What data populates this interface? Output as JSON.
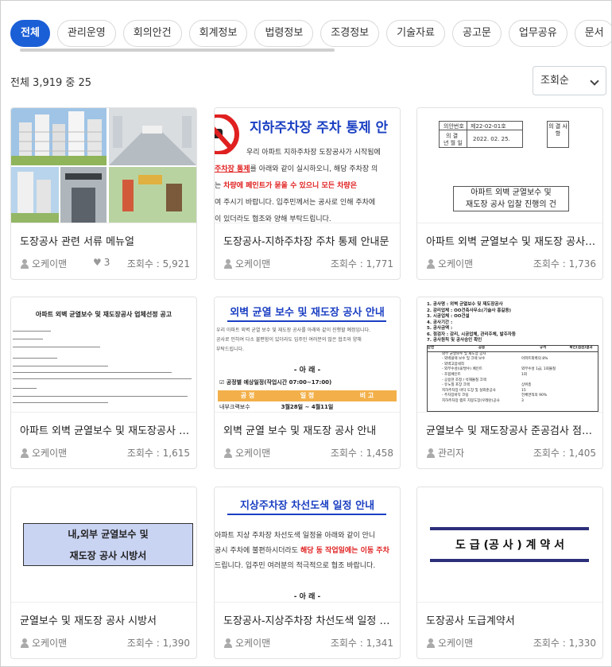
{
  "tabs": [
    "전체",
    "관리운영",
    "회의안건",
    "회계정보",
    "법령정보",
    "조경정보",
    "기술자료",
    "공고문",
    "업무공유",
    "문서"
  ],
  "summary": "전체 3,919 중 25",
  "sort": {
    "selected": "조회순"
  },
  "cards": [
    {
      "title": "도장공사 관련 서류 메뉴얼",
      "author": "오케이맨",
      "likes": "3",
      "views": "조회수 : 5,921"
    },
    {
      "title": "도장공사-지하주차장 주차 통제 안내문",
      "author": "오케이맨",
      "views": "조회수 : 1,771",
      "thumb": {
        "heading": "지하주차장 주차 통제 안",
        "l1": "우리 아파트 지하주차장 도장공사가 시작됨에",
        "l2a": "주차장 통제",
        "l2b": "를 아래와 같이 실시하오니, 해당 주차장 의",
        "l3a": "는 ",
        "l3b": "차량에 페인트가 묻을 수 있으니 모든 차량은",
        "l4": "여 주시기 바랍니다. 입주민께서는 공사로 인해 주차에",
        "l5": "이 있더라도 협조와 양해 부탁드립니다."
      }
    },
    {
      "title": "아파트 외벽 균열보수 및 재도장 공사 입찰 진행의 건",
      "author": "오케이맨",
      "views": "조회수 : 1,736",
      "thumb": {
        "r1a": "의안번호",
        "r1b": "제22-02-01호",
        "r2a": "의 결",
        "r2b": "년 월 일",
        "r2c": "2022. 02. 25.",
        "side": "의 결 사 항",
        "box1": "아파트 외벽 균열보수 및",
        "box2": "재도장 공사 입찰 진행의 건"
      }
    },
    {
      "title": "아파트 외벽 균열보수 및 재도장공사 업체선정 공고",
      "author": "오케이맨",
      "views": "조회수 : 1,615",
      "thumb": {
        "heading": "아파트 외벽 균열보수 및 재도장공사 업체선정 공고"
      }
    },
    {
      "title": "외벽 균열 보수 및 재도장 공사 안내",
      "author": "오케이맨",
      "views": "조회수 : 1,458",
      "thumb": {
        "heading": "외벽 균열 보수 및 재도장 공사 안내",
        "l1": "우리 아파트 외벽 균열 보수 및 재도장 공사를 아래와 같이 진행할 예정입니다.",
        "l2": "공사로 인하여 다소 불편함이 있더라도 입주민 여러분의 많은 협조와 양해",
        "l3": "부탁드립니다.",
        "center": "- 아     래 -",
        "sched": "☑ 공정별 예상일정(작업시간 07:00~17:00)",
        "col1": "공  정",
        "col2": "일  정",
        "col3": "비  고",
        "row1a": "내부크랙보수",
        "row1b": "3월28일 ~ 4월11일"
      }
    },
    {
      "title": "균열보수 및 재도장공사 준공검사 점검표",
      "author": "관리자",
      "views": "조회수 : 1,405",
      "thumb": {
        "h1": "1. 공사명 : 외벽 균열보수 및 재도장공사",
        "h2": "2. 감리업체 : OO건축사무소(기술사 홍길동)",
        "h3": "3. 시공업체 : OO건설",
        "h4": "4. 공사기간 :",
        "h5": "5. 공사금액 :",
        "h6": "6. 점검자 : 감리, 시공업체, 관리주체, 발주자등",
        "h7": "7. 공사원칙 및 공사승인 확인",
        "c1": "순번",
        "c2": "공종",
        "c3": "규격",
        "c4": "확인(점검)결과",
        "r1": "외부 균열보수 및 재도장 공사",
        "r2": "- 외벽클랙 보수 및 크랙 보수",
        "r2c": "아파트외벽의 8%",
        "r3": "- 외벽고압세척",
        "r4": "- 외부수성(내/발수) 페인트",
        "r4c": "외부수성 1급, 1회몰칠",
        "r5": "- 조합페인트",
        "r5c": "1회",
        "r6": "- 공용현 조정 / 석재몰칠 크랙",
        "r7": "- 유노칠 포장 크랙",
        "r7c": "상위층",
        "r8": "지하주차장 바닥 도장 및 실외준공사",
        "r8c": "15",
        "r9": "- 주차장바닥 코팅",
        "r9c": "전체면적의 90%",
        "r10": "지하주차장 램프 지붕도장(우레탄)공사",
        "r10c": "3"
      }
    },
    {
      "title": "균열보수 및 재도장 공사 시방서",
      "author": "오케이맨",
      "views": "조회수 : 1,390",
      "thumb": {
        "l1": "내,외부 균열보수 및",
        "l2": "재도장 공사 시방서"
      }
    },
    {
      "title": "도장공사-지상주차장 차선도색 일정 안내문",
      "author": "오케이맨",
      "views": "조회수 : 1,341",
      "thumb": {
        "heading": "지상주차장 차선도색 일정 안내",
        "l1": "아파트 지상 주차장 차선도색 일정을 아래와 같이 안니",
        "l2a": "공시 주차에 불편하시더라도 ",
        "l2b": "해당 동 작업일에는 이동 주차",
        "l3": "드립니다. 입주민 여러분의 적극적으로 협조 바랍니다.",
        "center": "- 아     래 -"
      }
    },
    {
      "title": "도장공사 도급계약서",
      "author": "오케이맨",
      "views": "조회수 : 1,330",
      "thumb": {
        "label": "도 급 (공 사 ) 계 약 서"
      }
    }
  ],
  "colors": {
    "accent": "#1a5fd6",
    "red": "#e02020",
    "navy": "#2c2f7a",
    "orange": "#f3b04a"
  }
}
